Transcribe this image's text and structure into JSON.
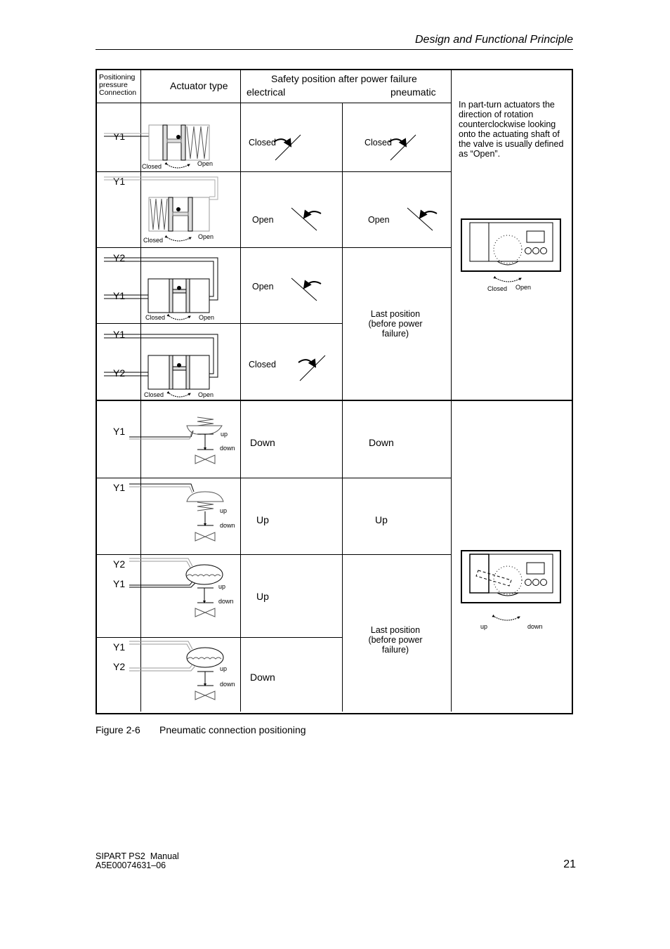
{
  "header": {
    "section_title": "Design and Functional Principle"
  },
  "table": {
    "headers": {
      "connection": "Positioning pressure Connection",
      "actuator_type": "Actuator type",
      "safety_position": "Safety position after power failure",
      "electrical": "electrical",
      "pneumatic": "pneumatic"
    },
    "part_turn_rows": [
      {
        "ports": [
          "Y1"
        ],
        "electrical": "Closed",
        "pneumatic": "Closed",
        "diagram_labels": [
          "Closed",
          "Open"
        ]
      },
      {
        "ports": [
          "Y1"
        ],
        "electrical": "Open",
        "pneumatic": "Open",
        "diagram_labels": [
          "Closed",
          "Open"
        ]
      },
      {
        "ports": [
          "Y2",
          "Y1"
        ],
        "electrical": "Open",
        "pneumatic": "Last position (before power failure)",
        "diagram_labels": [
          "Closed",
          "Open"
        ]
      },
      {
        "ports": [
          "Y1",
          "Y2"
        ],
        "electrical": "Closed",
        "pneumatic": "",
        "diagram_labels": [
          "Closed",
          "Open"
        ]
      }
    ],
    "linear_rows": [
      {
        "ports": [
          "Y1"
        ],
        "electrical": "Down",
        "pneumatic": "Down",
        "diagram_labels": [
          "up",
          "down"
        ]
      },
      {
        "ports": [
          "Y1"
        ],
        "electrical": "Up",
        "pneumatic": "Up",
        "diagram_labels": [
          "up",
          "down"
        ]
      },
      {
        "ports": [
          "Y2",
          "Y1"
        ],
        "electrical": "Up",
        "pneumatic": "Last position (before power failure)",
        "diagram_labels": [
          "up",
          "down"
        ]
      },
      {
        "ports": [
          "Y1",
          "Y2"
        ],
        "electrical": "Down",
        "pneumatic": "",
        "diagram_labels": [
          "up",
          "down"
        ]
      }
    ],
    "note_part_turn": "In part-turn actuators the direction of rotation counterclockwise looking onto the actuating shaft of the valve is usually defined as “Open”.",
    "positioner_part_turn_labels": [
      "Closed",
      "Open"
    ],
    "positioner_linear_labels": [
      "up",
      "down"
    ],
    "last_position_line1": "Last position",
    "last_position_line2": "(before power",
    "last_position_line3": "failure)"
  },
  "caption": {
    "label": "Figure 2-6",
    "text": "Pneumatic connection positioning"
  },
  "footer": {
    "manual": "SIPART PS2  Manual",
    "doc_number": "A5E00074631–06",
    "page_number": "21"
  }
}
